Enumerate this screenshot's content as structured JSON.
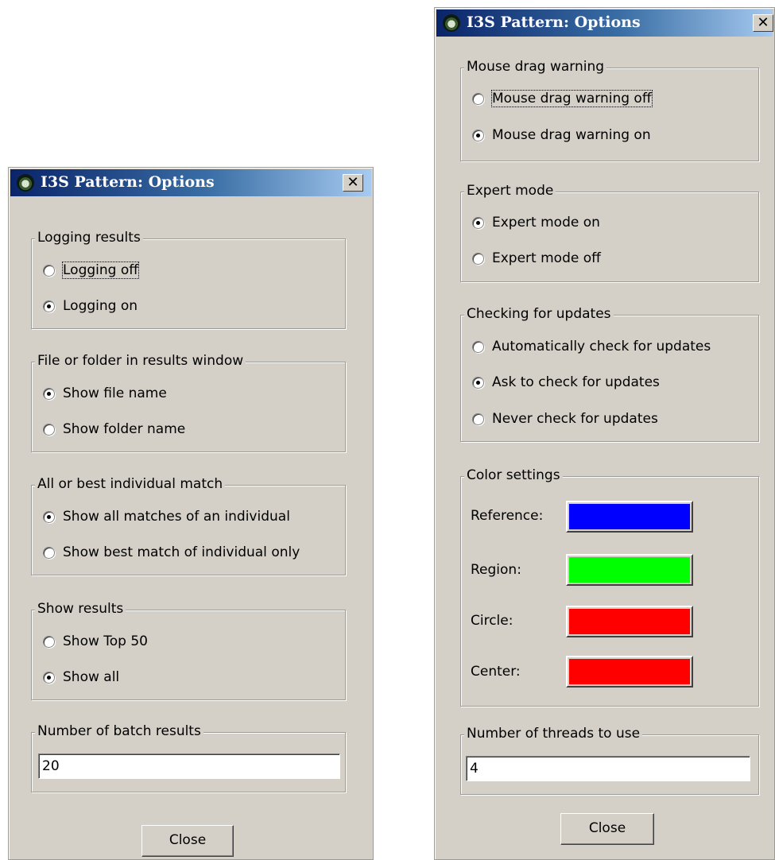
{
  "left_window": {
    "title": "I3S Pattern: Options",
    "close_glyph": "✕",
    "groups": [
      {
        "title": "Logging results",
        "options": [
          {
            "label": "Logging off",
            "selected": false,
            "focused": true
          },
          {
            "label": "Logging on",
            "selected": true
          }
        ]
      },
      {
        "title": "File or folder in results window",
        "options": [
          {
            "label": "Show file name",
            "selected": true
          },
          {
            "label": "Show folder name",
            "selected": false
          }
        ]
      },
      {
        "title": "All or best individual match",
        "options": [
          {
            "label": "Show all matches of an individual",
            "selected": true
          },
          {
            "label": "Show best match of individual only",
            "selected": false
          }
        ]
      },
      {
        "title": "Show results",
        "options": [
          {
            "label": "Show Top 50",
            "selected": false
          },
          {
            "label": "Show all",
            "selected": true
          }
        ]
      }
    ],
    "batch": {
      "title": "Number of batch results",
      "value": "20"
    },
    "close_button": "Close"
  },
  "right_window": {
    "title": "I3S Pattern: Options",
    "close_glyph": "✕",
    "groups": [
      {
        "title": "Mouse drag warning",
        "options": [
          {
            "label": "Mouse drag warning off",
            "selected": false,
            "focused": true
          },
          {
            "label": "Mouse drag warning on",
            "selected": true
          }
        ]
      },
      {
        "title": "Expert mode",
        "options": [
          {
            "label": "Expert mode on",
            "selected": true
          },
          {
            "label": "Expert mode off",
            "selected": false
          }
        ]
      },
      {
        "title": "Checking for updates",
        "options": [
          {
            "label": "Automatically check for updates",
            "selected": false
          },
          {
            "label": "Ask to check for updates",
            "selected": true
          },
          {
            "label": "Never check for updates",
            "selected": false
          }
        ]
      }
    ],
    "color_settings": {
      "title": "Color settings",
      "items": [
        {
          "label": "Reference:",
          "color": "#0000ff"
        },
        {
          "label": "Region:",
          "color": "#00ff00"
        },
        {
          "label": "Circle:",
          "color": "#ff0000"
        },
        {
          "label": "Center:",
          "color": "#ff0000"
        }
      ]
    },
    "threads": {
      "title": "Number of threads to use",
      "value": "4"
    },
    "close_button": "Close"
  }
}
